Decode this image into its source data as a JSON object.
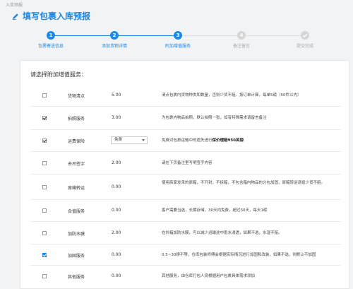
{
  "breadcrumb": "入库预报",
  "page": {
    "title": "填写包裹入库预报"
  },
  "steps": [
    {
      "num": "1",
      "label": "包裹寄送信息",
      "state": "active"
    },
    {
      "num": "2",
      "label": "添加货物详情",
      "state": "active"
    },
    {
      "num": "3",
      "label": "附加增值服务",
      "state": "active"
    },
    {
      "num": "4",
      "label": "备注留言",
      "state": "inactive"
    },
    {
      "num": "",
      "label": "提交完成",
      "state": "inactive"
    }
  ],
  "panel": {
    "heading": "请选择附加增值服务："
  },
  "services": [
    {
      "checked": false,
      "name": "货物清点",
      "price": "5.00",
      "desc": "清点包裹内货物种类和数量，否则少货不赔。按订单计算，每单5磅（50件以内）"
    },
    {
      "checked": true,
      "name": "拍照服务",
      "price": "3.00",
      "desc": "为包裹内物品拍照，默认拍照一张，如有特殊需求请留言备注"
    },
    {
      "checked": true,
      "name": "运费保险",
      "select": "免费",
      "desc_pre": "免费对包裹运输中的遗失进行",
      "desc_bold": "保价理赔¥50英镑",
      "desc": ""
    },
    {
      "checked": false,
      "name": "去吊签字",
      "price": "2.00",
      "desc": "请在下页备注里写明签字内容"
    },
    {
      "checked": false,
      "name": "原箱转运",
      "price": "0.00",
      "desc": "使用商家发来的原箱，不开封，不拆箱，不包含箱内物品的分包加固，原箱转运请投少货不赔。"
    },
    {
      "checked": false,
      "name": "合值服务",
      "price": "0.00",
      "desc": "客户需要当选，长期存储，30天内免费，超过30天，每天1磅"
    },
    {
      "checked": false,
      "name": "加防水膜",
      "price": "2.00",
      "desc": "在外箱加防水膜，可以减少运输途中雨水浸透，如果不选，水湿不赔。"
    },
    {
      "checked": true,
      "blue": true,
      "name": "加固服务",
      "price": "0.00",
      "desc": "0.5~30镑不等，仓库包装师傅会根据实际情况进行加固和改装，如果不选，则默认不加固"
    },
    {
      "checked": false,
      "name": "其他服务",
      "price": "0.00",
      "desc": "其他服务，由仓库打包人员根据用户包裹具体需求添加"
    }
  ]
}
